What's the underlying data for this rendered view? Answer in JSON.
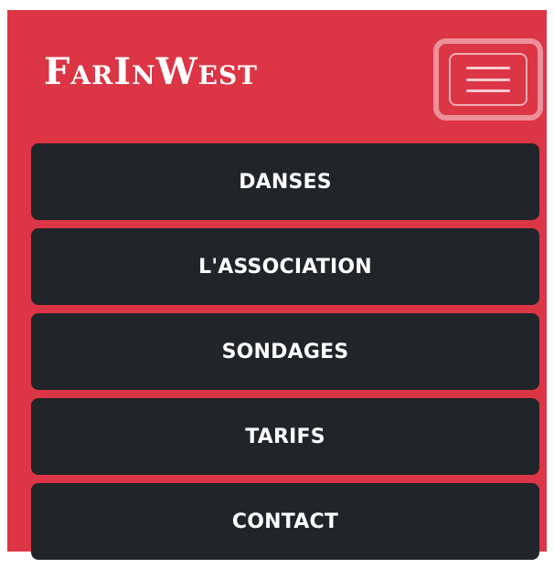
{
  "theme": {
    "accent": "#dc3545",
    "menu_bg": "#212529",
    "text": "#ffffff"
  },
  "header": {
    "brand": "FarInWest",
    "toggle_icon": "hamburger-icon"
  },
  "menu": {
    "items": [
      {
        "label": "DANSES"
      },
      {
        "label": "L'ASSOCIATION"
      },
      {
        "label": "SONDAGES"
      },
      {
        "label": "TARIFS"
      },
      {
        "label": "CONTACT"
      }
    ]
  }
}
